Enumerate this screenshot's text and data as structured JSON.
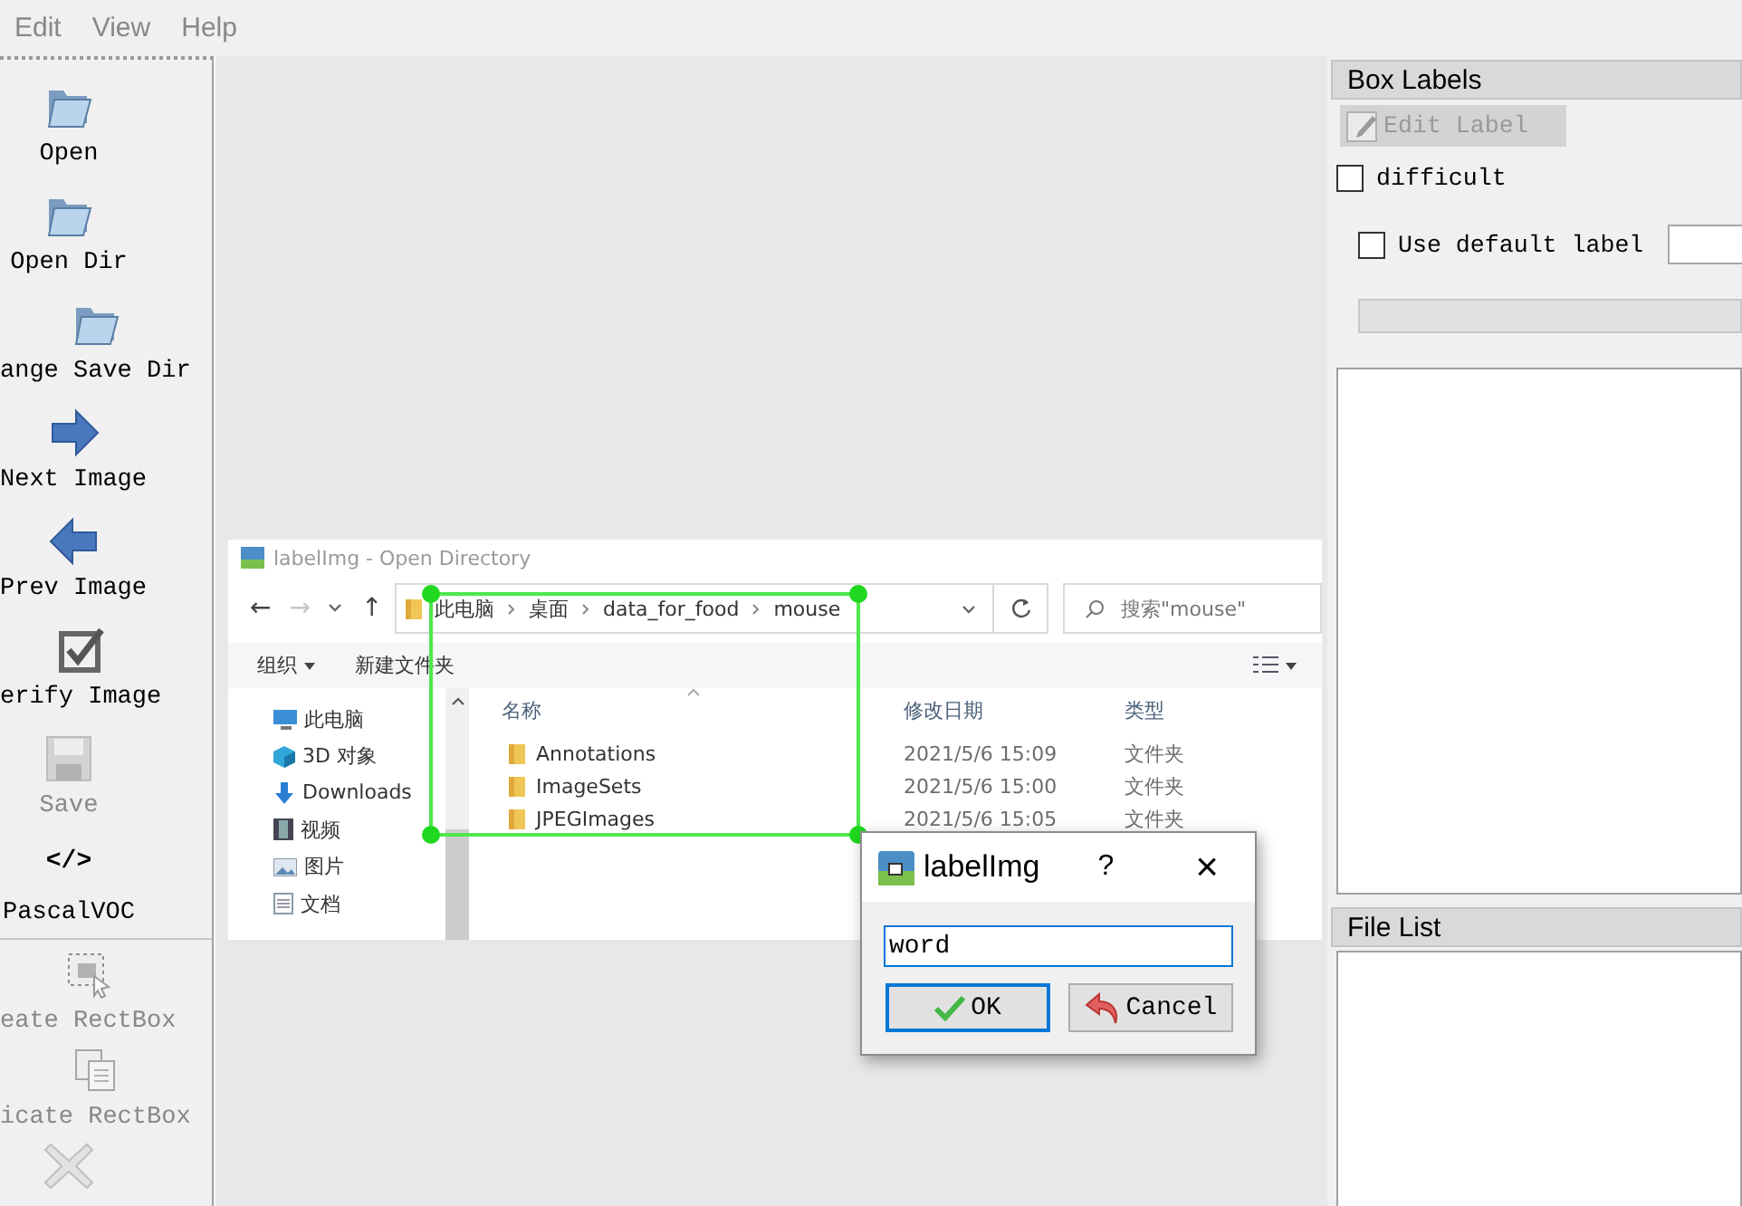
{
  "menu": [
    {
      "label": "Edit"
    },
    {
      "label": "View"
    },
    {
      "label": "Help"
    }
  ],
  "toolbar": [
    {
      "kind": "button",
      "label": "Open",
      "disabled": false
    },
    {
      "kind": "button",
      "label": "Open Dir",
      "disabled": false
    },
    {
      "kind": "button",
      "label": "ange Save Dir",
      "disabled": false
    },
    {
      "kind": "button",
      "label": "Next Image",
      "disabled": false
    },
    {
      "kind": "button",
      "label": "Prev Image",
      "disabled": false
    },
    {
      "kind": "button",
      "label": "erify Image",
      "disabled": false
    },
    {
      "kind": "button",
      "label": "Save",
      "disabled": true
    },
    {
      "kind": "format",
      "glyph": "</>",
      "label": "PascalVOC",
      "disabled": false
    },
    {
      "kind": "separator"
    },
    {
      "kind": "button",
      "label": "eate RectBox",
      "disabled": true
    },
    {
      "kind": "button",
      "label": "icate RectBox",
      "disabled": true
    },
    {
      "kind": "button",
      "disabled": true
    }
  ],
  "canvas": {
    "image": {
      "title": "labelImg - Open Directory",
      "nav": [
        {
          "kind": "glyph",
          "text": "←",
          "disabled": false
        },
        {
          "kind": "glyph",
          "text": "→",
          "disabled": true
        },
        {
          "kind": "chevron"
        },
        {
          "kind": "glyph",
          "text": "↑",
          "disabled": false
        }
      ],
      "breadcrumb": [
        "此电脑",
        "桌面",
        "data_for_food",
        "mouse"
      ],
      "search": {
        "placeholder": "搜索\"mouse\""
      },
      "commands": [
        {
          "label": "组织",
          "dropdown": true
        },
        {
          "label": "新建文件夹",
          "dropdown": false
        }
      ],
      "tree": [
        {
          "label": "此电脑"
        },
        {
          "label": "3D 对象"
        },
        {
          "label": "Downloads"
        },
        {
          "label": "视频"
        },
        {
          "label": "图片"
        },
        {
          "label": "文档"
        }
      ],
      "columns": [
        "名称",
        "修改日期",
        "类型"
      ],
      "rows": [
        {
          "name": "Annotations",
          "modified": "2021/5/6 15:09",
          "type": "文件夹"
        },
        {
          "name": "ImageSets",
          "modified": "2021/5/6 15:00",
          "type": "文件夹"
        },
        {
          "name": "JPEGImages",
          "modified": "2021/5/6 15:05",
          "type": "文件夹"
        }
      ]
    },
    "dialog": {
      "title": "labelImg",
      "help": "?",
      "close": "×",
      "value": "word",
      "buttons": [
        {
          "label": "OK",
          "focused": true
        },
        {
          "label": "Cancel",
          "focused": false
        }
      ]
    }
  },
  "dock": {
    "box_labels": {
      "title": "Box Labels",
      "edit_button": {
        "label": "Edit Label",
        "disabled": true
      },
      "difficult": {
        "label": "difficult",
        "checked": false
      },
      "use_default": {
        "label": "Use default label",
        "checked": false
      }
    },
    "file_list": {
      "title": "File List"
    }
  }
}
